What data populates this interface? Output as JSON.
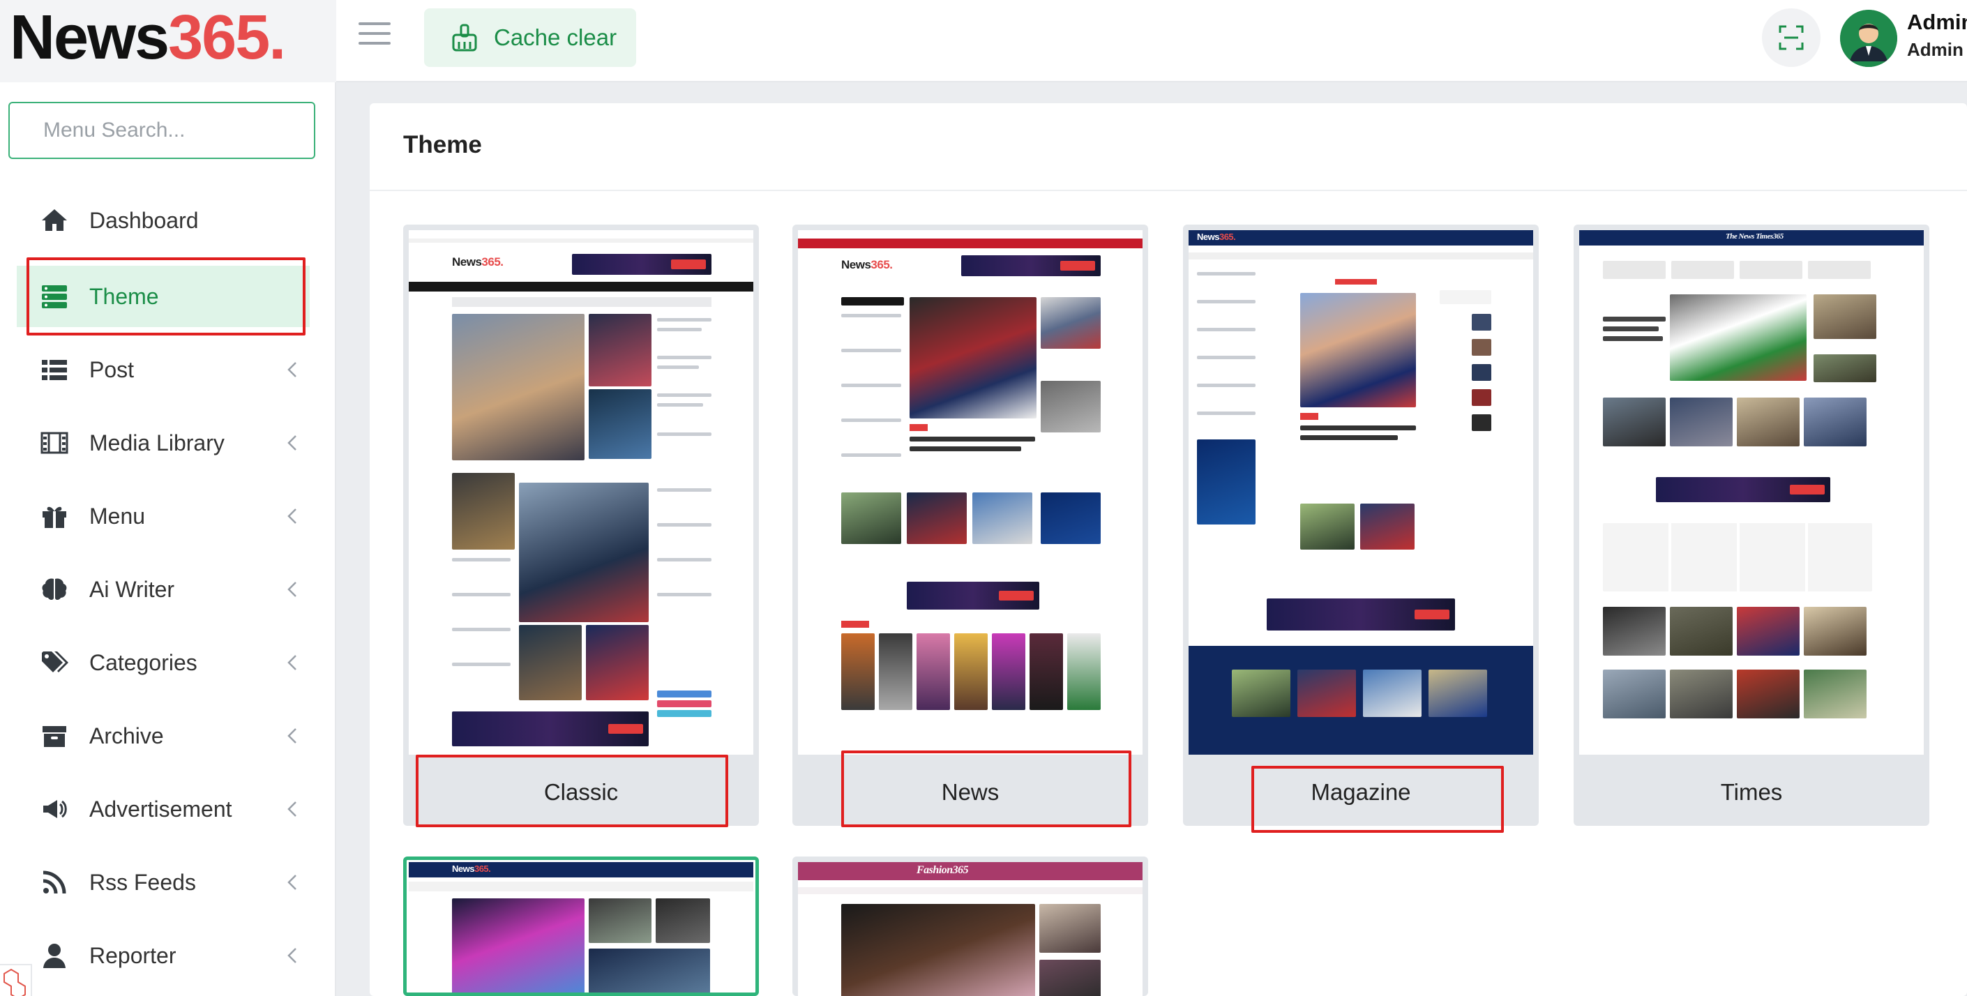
{
  "header": {
    "logo_main": "News",
    "logo_accent": "365.",
    "cache_clear_label": "Cache clear",
    "user_name": "Admin",
    "user_role": "Admin"
  },
  "sidebar": {
    "search_placeholder": "Menu Search...",
    "items": [
      {
        "label": "Dashboard",
        "icon": "home-icon"
      },
      {
        "label": "Theme",
        "icon": "theme-icon",
        "active": true
      },
      {
        "label": "Post",
        "icon": "list-icon"
      },
      {
        "label": "Media Library",
        "icon": "film-icon"
      },
      {
        "label": "Menu",
        "icon": "gift-icon"
      },
      {
        "label": "Ai Writer",
        "icon": "brain-icon"
      },
      {
        "label": "Categories",
        "icon": "tags-icon"
      },
      {
        "label": "Archive",
        "icon": "archive-icon"
      },
      {
        "label": "Advertisement",
        "icon": "megaphone-icon"
      },
      {
        "label": "Rss Feeds",
        "icon": "rss-icon"
      },
      {
        "label": "Reporter",
        "icon": "user-icon"
      }
    ]
  },
  "main": {
    "title": "Theme",
    "themes": [
      {
        "label": "Classic",
        "thumb_logo": "News",
        "thumb_logo_accent": "365."
      },
      {
        "label": "News",
        "thumb_logo": "News",
        "thumb_logo_accent": "365."
      },
      {
        "label": "Magazine",
        "thumb_logo": "News",
        "thumb_logo_accent": "365."
      },
      {
        "label": "Times",
        "thumb_logo": "The News Times365"
      },
      {
        "label": "",
        "thumb_logo": "News",
        "thumb_logo_accent": "365.",
        "selected": true
      },
      {
        "label": "",
        "thumb_logo": "Fashion365"
      }
    ]
  },
  "colors": {
    "accent_green": "#1a8d47",
    "active_bg": "#dff4e8",
    "highlight_red": "#e01f1f",
    "logo_red": "#e74c4c",
    "magazine_navy": "#10285e"
  }
}
